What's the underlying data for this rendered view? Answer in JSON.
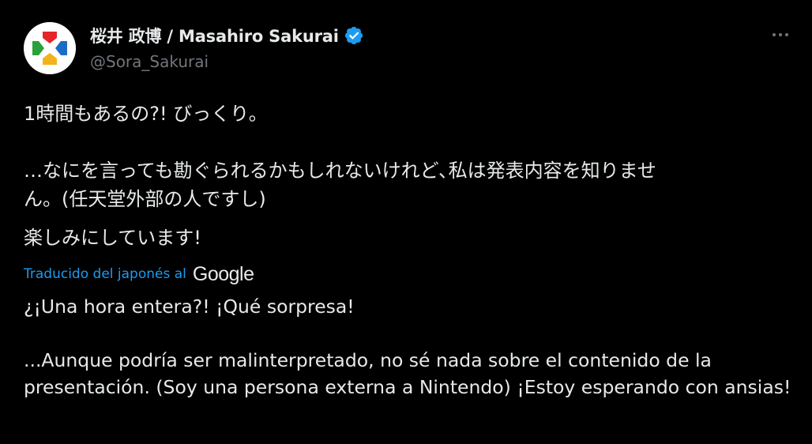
{
  "author": {
    "display_name": "桜井 政博 / Masahiro Sakurai",
    "handle": "@Sora_Sakurai",
    "verified": true,
    "avatar": "red-green-blue-yellow-cross-logo"
  },
  "menu": {
    "icon": "more-horizontal-icon"
  },
  "tweet": {
    "original_line_1": "1時間もあるの?! びっくり。",
    "original_line_2": "…なにを言っても勘ぐられるかもしれないけれど､私は発表内容を知りませ",
    "original_line_3": "ん。(任天堂外部の人ですし)",
    "original_line_4": "楽しみにしています!",
    "translated_label": "Traducido del japonés al",
    "translator_brand": "Google",
    "translation_line_1": "¿¡Una hora entera?! ¡Qué sorpresa!",
    "translation_paragraph_2": "...Aunque podría ser malinterpretado, no sé nada sobre el contenido de la presentación. (Soy una persona externa a Nintendo) ¡Estoy esperando con ansias!"
  },
  "colors": {
    "background": "#000000",
    "text": "#e7e9ea",
    "muted": "#71767b",
    "link": "#1d9bf0",
    "verified": "#1d9bf0"
  }
}
